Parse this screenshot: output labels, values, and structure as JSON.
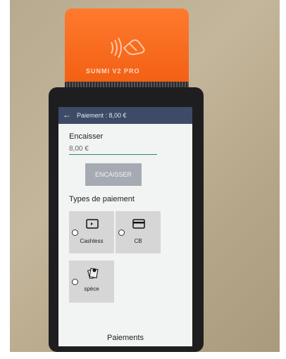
{
  "device": {
    "brand": "SUNMI V2 PRO"
  },
  "app": {
    "title": "Paiement : 8,00 €",
    "encaisser_label": "Encaisser",
    "amount_value": "8,00 €",
    "encaisser_button": "ENCAISSER",
    "types_title": "Types de paiement",
    "payment_types": [
      {
        "label": "Cashless",
        "icon": "cashless-card-icon"
      },
      {
        "label": "CB",
        "icon": "credit-card-icon"
      },
      {
        "label": "spèce",
        "icon": "cash-notes-icon"
      }
    ],
    "footer": "Paiements"
  },
  "colors": {
    "printer_orange": "#f25e12",
    "appbar": "#3d4b66",
    "input_underline": "#2f8a76",
    "button_gray": "#a6aab2"
  }
}
